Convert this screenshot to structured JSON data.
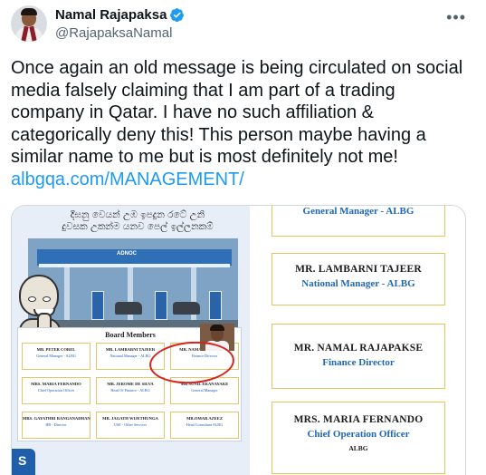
{
  "author": {
    "display_name": "Namal Rajapaksa",
    "handle": "@RajapaksaNamal",
    "verified": true
  },
  "tweet": {
    "text": "Once again an old message is being circulated on social media falsely claiming that I am part of a trading company in Qatar. I have no such affiliation & categorically deny this! This person maybe having a similar name to me but is most definitely not me!",
    "link": "albgqa.com/MANAGEMENT/"
  },
  "media": {
    "left": {
      "sinhala_line1": "දීඝනු වෙයන් උඹ ඉපදුන රටේ උනි",
      "sinhala_line2": "දුවසක උකන්ම යනව පෙල් ඉල්ලනකම්",
      "station_brand": "ADNOC",
      "board_title": "Board Members",
      "members": [
        {
          "name": "MR. PETER COREL",
          "role": "General Manager - ALBG"
        },
        {
          "name": "MR. LAMBARNI TAJEER",
          "role": "National Manager - ALBG"
        },
        {
          "name": "MR. NAMAL RAJAPAKSE",
          "role": "Finance Director"
        },
        {
          "name": "MRS. MARIA FERNANDO",
          "role": "Chief Operation Officer"
        },
        {
          "name": "MR. JEROME DE SILVA",
          "role": "Head Of Finance - ALBG"
        },
        {
          "name": "MR SUNIL EKANAYAKE",
          "role": "General Manager"
        },
        {
          "name": "MRS. GAYATHRI RANGANADHAN",
          "role": "HR - Director"
        },
        {
          "name": "MR. JAGATH WIJETHUNGA",
          "role": "USE - Other Services"
        },
        {
          "name": "MR.OMAR AZEEZ",
          "role": "Head Consultant ALBG"
        }
      ]
    },
    "right": {
      "cards": [
        {
          "name": "",
          "role": "General Manager - ALBG",
          "sub": ""
        },
        {
          "name": "MR. LAMBARNI TAJEER",
          "role": "National Manager - ALBG",
          "sub": ""
        },
        {
          "name": "MR. NAMAL RAJAPAKSE",
          "role": "Finance Director",
          "sub": ""
        },
        {
          "name": "MRS. MARIA FERNANDO",
          "role": "Chief Operation Officer",
          "sub": "ALBG"
        }
      ]
    }
  },
  "colors": {
    "link": "#1d9bf0",
    "verified": "#1d9bf0",
    "card_border": "#e6c35a",
    "role_blue": "#1f67b8",
    "highlight_ring": "#d8231c"
  },
  "icons": [
    "verified-badge-icon",
    "more-options-icon"
  ]
}
